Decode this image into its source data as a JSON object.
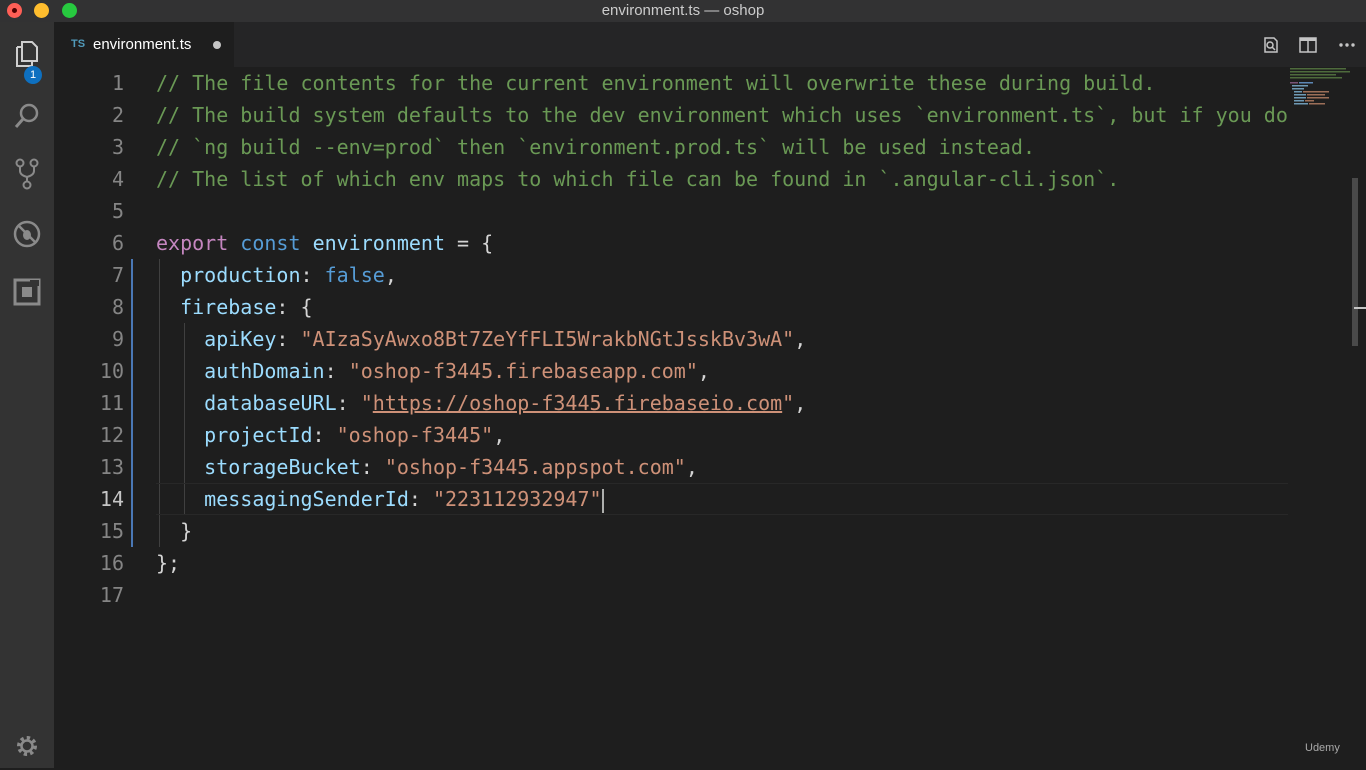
{
  "window": {
    "title": "environment.ts — oshop"
  },
  "activity_bar": {
    "items": [
      {
        "name": "explorer",
        "icon": "files-icon",
        "badge": "1"
      },
      {
        "name": "search",
        "icon": "search-icon"
      },
      {
        "name": "source-control",
        "icon": "source-control-icon"
      },
      {
        "name": "debug",
        "icon": "debug-icon"
      },
      {
        "name": "extensions",
        "icon": "extensions-icon"
      }
    ],
    "settings_icon": "gear-icon"
  },
  "tab": {
    "lang_badge": "TS",
    "filename": "environment.ts",
    "modified": true
  },
  "toolbar": {
    "icons": [
      "open-preview-icon",
      "split-editor-icon",
      "more-actions-icon"
    ]
  },
  "editor": {
    "line_numbers": [
      "1",
      "2",
      "3",
      "4",
      "5",
      "6",
      "7",
      "8",
      "9",
      "10",
      "11",
      "12",
      "13",
      "14",
      "15",
      "16",
      "17"
    ],
    "lines": [
      "// The file contents for the current environment will overwrite these during build.",
      "// The build system defaults to the dev environment which uses `environment.ts`, but if you do",
      "// `ng build --env=prod` then `environment.prod.ts` will be used instead.",
      "// The list of which env maps to which file can be found in `.angular-cli.json`.",
      "",
      "export const environment = {",
      "  production: false,",
      "  firebase: {",
      "    apiKey: \"AIzaSyAwxo8Bt7ZeYfFLI5WrakbNGtJsskBv3wA\",",
      "    authDomain: \"oshop-f3445.firebaseapp.com\",",
      "    databaseURL: \"https://oshop-f3445.firebaseio.com\",",
      "    projectId: \"oshop-f3445\",",
      "    storageBucket: \"oshop-f3445.appspot.com\",",
      "    messagingSenderId: \"223112932947\"",
      "  }",
      "};",
      ""
    ],
    "tokens": {
      "l6_export": "export",
      "l6_const": "const",
      "l6_var": "environment",
      "l6_rest": " = {",
      "l7_prop": "production",
      "l7_colon": ": ",
      "l7_val": "false",
      "l7_end": ",",
      "l8_prop": "firebase",
      "l8_rest": ": {",
      "l9_prop": "apiKey",
      "l9_val": "\"AIzaSyAwxo8Bt7ZeYfFLI5WrakbNGtJsskBv3wA\"",
      "l10_prop": "authDomain",
      "l10_val": "\"oshop-f3445.firebaseapp.com\"",
      "l11_prop": "databaseURL",
      "l11_q1": "\"",
      "l11_url": "https://oshop-f3445.firebaseio.com",
      "l11_q2": "\"",
      "l12_prop": "projectId",
      "l12_val": "\"oshop-f3445\"",
      "l13_prop": "storageBucket",
      "l13_val": "\"oshop-f3445.appspot.com\"",
      "l14_prop": "messagingSenderId",
      "l14_val": "\"223112932947\"",
      "l15": "}",
      "l16": "};",
      "colon": ": ",
      "comma": ","
    }
  },
  "watermark": "Udemy",
  "colors": {
    "comment": "#6a9955",
    "keyword": "#c586c0",
    "storage": "#569cd6",
    "variable": "#9cdcfe",
    "string": "#ce9178"
  }
}
